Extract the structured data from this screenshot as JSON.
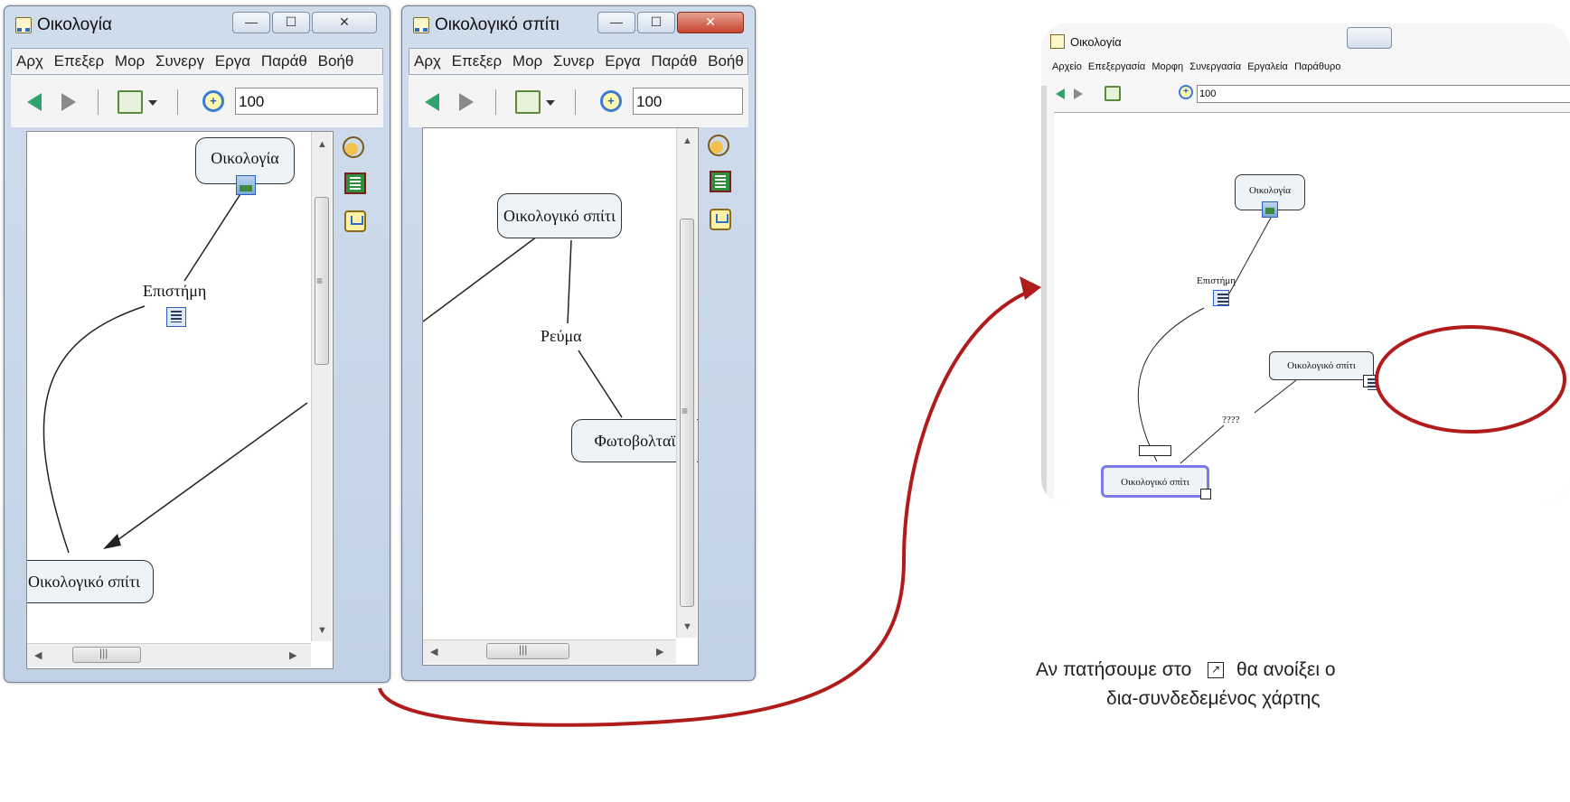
{
  "window1": {
    "title": "Οικολογία",
    "menu": [
      "Αρχ",
      "Επεξερ",
      "Μορ",
      "Συνεργ",
      "Εργα",
      "Παράθ",
      "Βοήθ"
    ],
    "zoom": "100",
    "concepts": [
      "Οικολογία",
      "Οικολογικό σπίτι"
    ],
    "link_label": "Επιστήμη"
  },
  "window2": {
    "title": "Οικολογικό σπίτι",
    "menu": [
      "Αρχ",
      "Επεξερ",
      "Μορ",
      "Συνερ",
      "Εργα",
      "Παράθ",
      "Βοήθ"
    ],
    "zoom": "100",
    "concepts": [
      "Οικολογικό σπίτι",
      "Φωτοβολταϊ"
    ],
    "link_label": "Ρεύμα"
  },
  "screenshot": {
    "title": "Οικολογία",
    "menu": [
      "Αρχείο",
      "Επεξεργασία",
      "Μορφη",
      "Συνεργασία",
      "Εργαλεία",
      "Παράθυρο"
    ],
    "zoom": "100",
    "concepts": [
      "Οικολογία",
      "Οικολογικό σπίτι",
      "Οικολογικό σπίτι"
    ],
    "link_labels": [
      "Επιστήμη",
      "????"
    ]
  },
  "caption": {
    "line1_before": "Αν πατήσουμε στο",
    "line1_after": "θα ανοίξει ο",
    "line2": "δια-συνδεδεμένος χάρτης"
  },
  "colors": {
    "highlight": "#b01c1c",
    "selected_node_border": "#7a7ae8"
  }
}
